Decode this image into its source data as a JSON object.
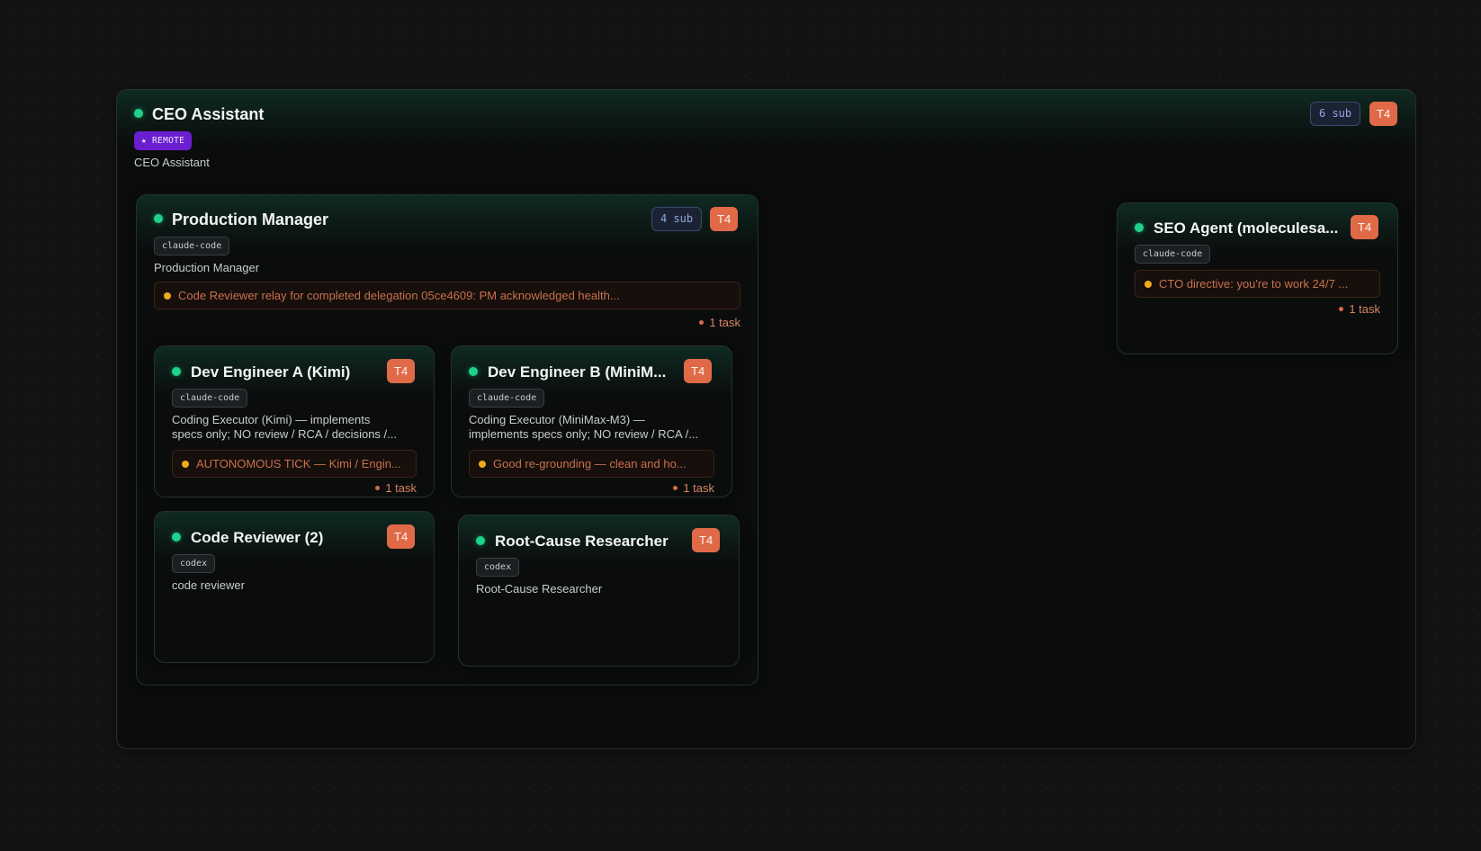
{
  "ceo": {
    "title": "CEO Assistant",
    "badge": "★ REMOTE",
    "description": "CEO Assistant",
    "sub_count": "6 sub",
    "tier": "T4"
  },
  "production_manager": {
    "title": "Production Manager",
    "runtime": "claude-code",
    "description": "Production Manager",
    "task_text": "Code Reviewer relay for completed delegation 05ce4609: PM acknowledged health...",
    "task_count": "1 task",
    "sub_count": "4 sub",
    "tier": "T4"
  },
  "dev_a": {
    "title": "Dev Engineer A (Kimi)",
    "runtime": "claude-code",
    "description_line1": "Coding Executor (Kimi) — implements",
    "description_line2": "specs only; NO review / RCA / decisions /...",
    "task_text": "AUTONOMOUS TICK — Kimi / Engin...",
    "task_count": "1 task",
    "tier": "T4"
  },
  "dev_b": {
    "title": "Dev Engineer B (MiniM...",
    "runtime": "claude-code",
    "description_line1": "Coding Executor (MiniMax-M3) —",
    "description_line2": "implements specs only; NO review / RCA /...",
    "task_text": "Good re-grounding — clean and ho...",
    "task_count": "1 task",
    "tier": "T4"
  },
  "code_reviewer": {
    "title": "Code Reviewer (2)",
    "runtime": "codex",
    "description": "code reviewer",
    "tier": "T4"
  },
  "rca": {
    "title": "Root-Cause Researcher",
    "runtime": "codex",
    "description": "Root-Cause Researcher",
    "tier": "T4"
  },
  "seo": {
    "title": "SEO Agent (moleculesa...",
    "runtime": "claude-code",
    "task_text": "CTO directive: you're to work 24/7 ...",
    "task_count": "1 task",
    "tier": "T4"
  },
  "colors": {
    "background": "#131313",
    "status_online": "#1ed28b",
    "tier_badge": "#e06a48",
    "remote_badge": "#6a1ed0",
    "task_dot": "#f0a91c"
  }
}
